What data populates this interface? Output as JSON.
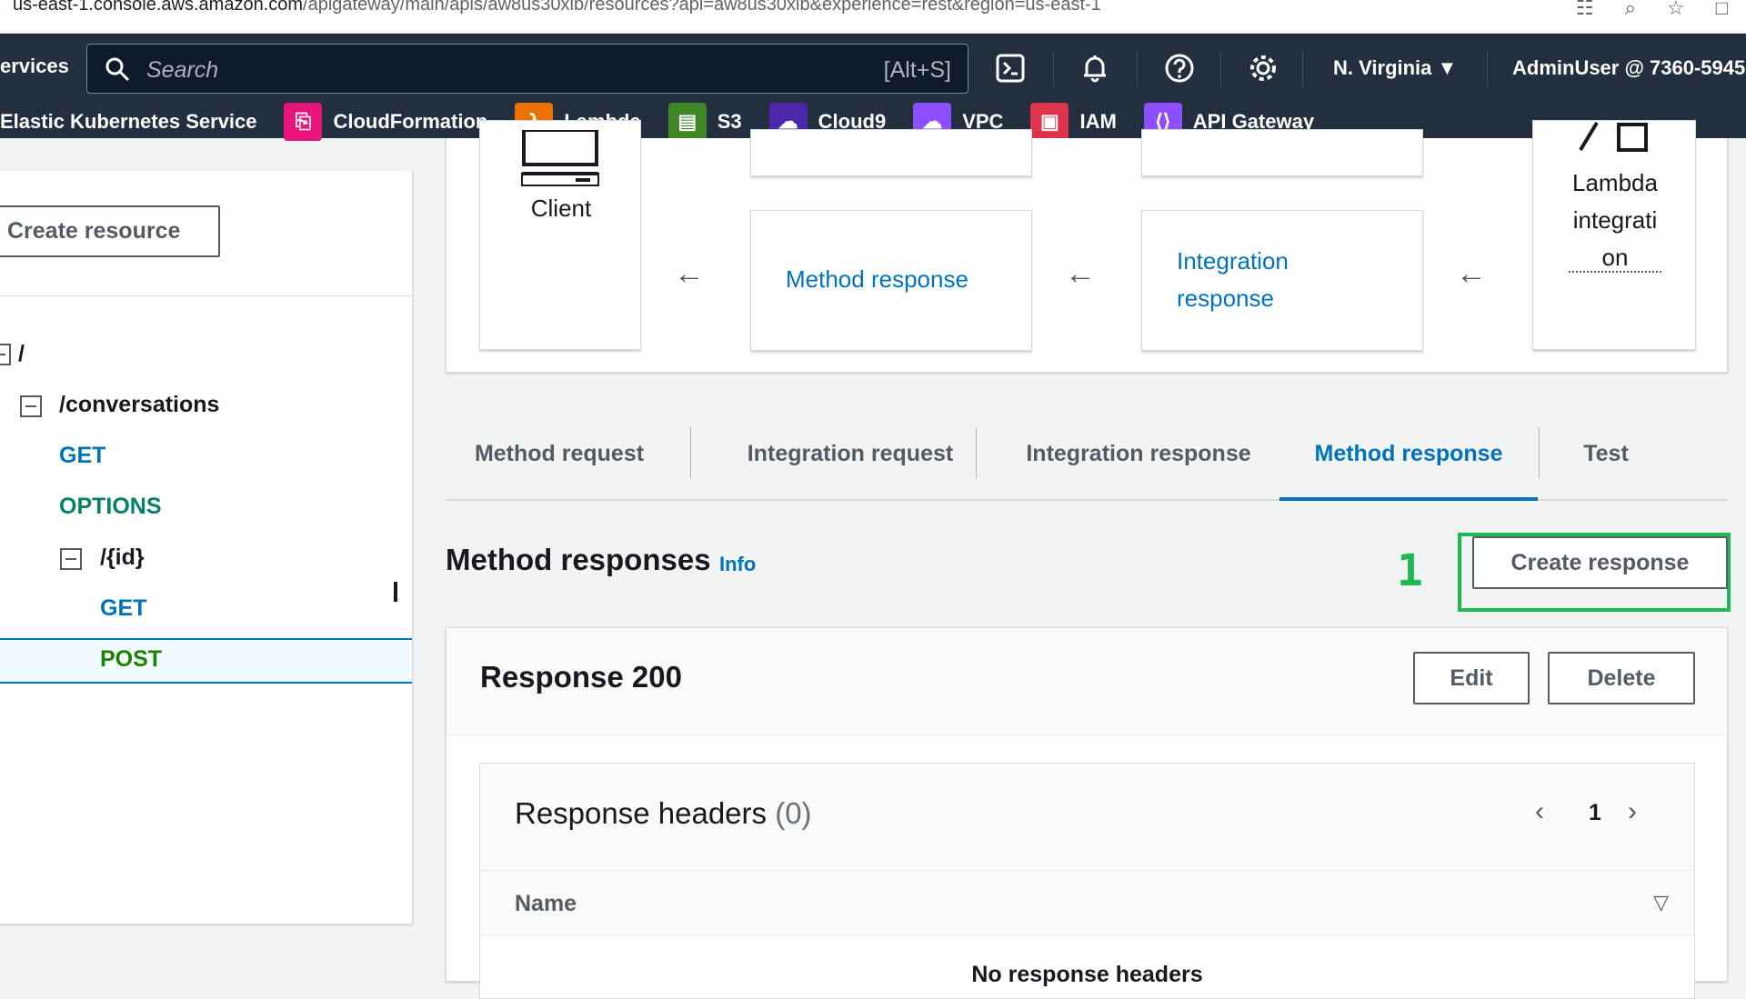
{
  "browser": {
    "url_host": "us-east-1.console.aws.amazon.com",
    "url_path": "/apigateway/main/apis/aw8us30xib/resources?api=aw8us30xib&experience=rest&region=us-east-1"
  },
  "nav": {
    "services_label": "ervices",
    "search_placeholder": "Search",
    "search_shortcut": "[Alt+S]",
    "region": "N. Virginia",
    "user": "AdminUser @ 7360-5945",
    "favorites": [
      {
        "label": "Elastic Kubernetes Service",
        "color": ""
      },
      {
        "label": "CloudFormation",
        "color": "#e7157b"
      },
      {
        "label": "Lambda",
        "color": "#ed7100"
      },
      {
        "label": "S3",
        "color": "#3f8624"
      },
      {
        "label": "Cloud9",
        "color": "#4d27aa"
      },
      {
        "label": "VPC",
        "color": "#8c4fff"
      },
      {
        "label": "IAM",
        "color": "#dd344c"
      },
      {
        "label": "API Gateway",
        "color": "#8c4fff"
      }
    ]
  },
  "left": {
    "create_resource": "Create resource",
    "root": "/",
    "conversations": "/conversations",
    "get1": "GET",
    "options": "OPTIONS",
    "id": "/{id}",
    "get2": "GET",
    "post": "POST"
  },
  "diagram": {
    "client": "Client",
    "method_response": "Method response",
    "integration_response_l1": "Integration",
    "integration_response_l2": "response",
    "lambda_l1": "Lambda",
    "lambda_l2": "integrati",
    "lambda_l3": "on",
    "arrow": "←"
  },
  "tabs": [
    {
      "label": "Method request"
    },
    {
      "label": "Integration request"
    },
    {
      "label": "Integration response"
    },
    {
      "label": "Method response"
    },
    {
      "label": "Test"
    }
  ],
  "method_responses": {
    "title": "Method responses",
    "info": "Info",
    "create_response": "Create response",
    "annotation": "1"
  },
  "response": {
    "title": "Response 200",
    "edit": "Edit",
    "delete": "Delete",
    "headers_title": "Response headers",
    "headers_count": "(0)",
    "page": "1",
    "col_name": "Name",
    "empty": "No response headers"
  },
  "colors": {
    "nav_bg": "#232f3e",
    "link": "#0073bb",
    "annotation": "#1db954"
  }
}
